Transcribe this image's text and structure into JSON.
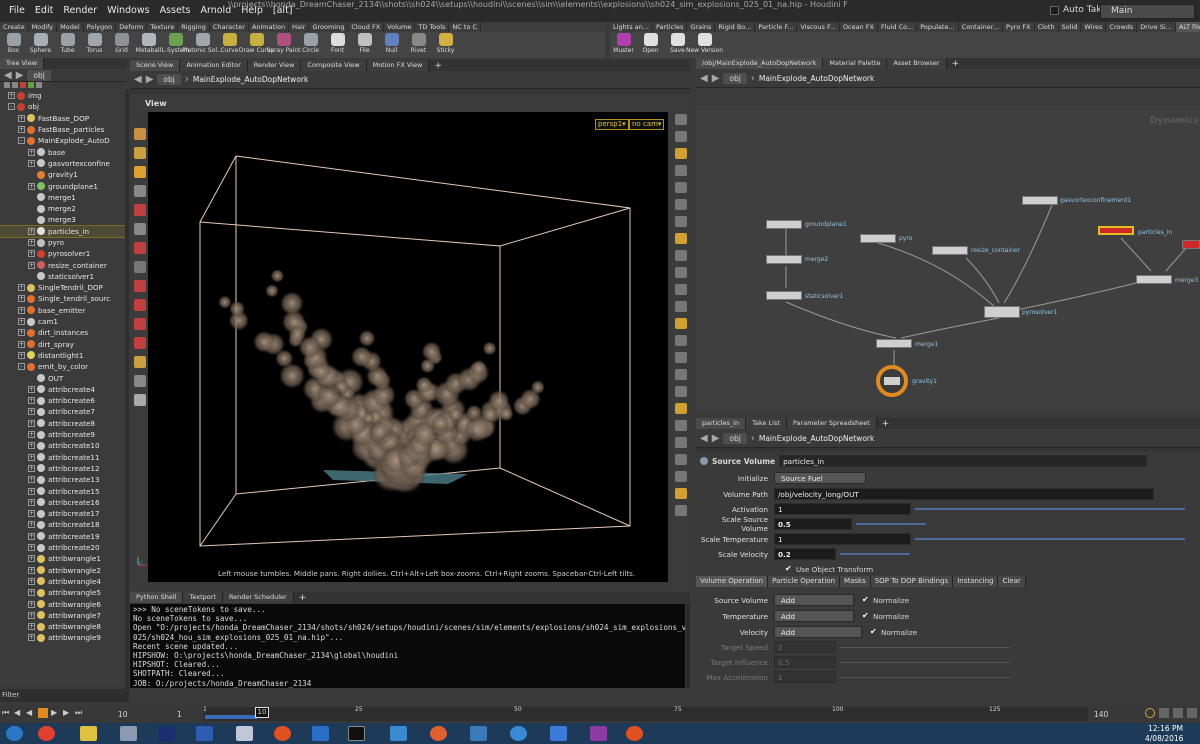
{
  "title_bar": "\\\\projects\\\\honda_DreamChaser_2134\\\\shots\\\\sh024\\\\setups\\\\houdini\\\\scenes\\\\sim\\\\elements\\\\explosions\\\\sh024_sim_explosions_025_01_na.hip - Houdini FX 15.0.313",
  "menu": [
    "File",
    "Edit",
    "Render",
    "Windows",
    "Assets",
    "Arnold",
    "Help",
    "[alt]"
  ],
  "auto_takes": "Auto Takes",
  "take": "Main",
  "shelf_tabs_left": [
    "Create",
    "Modify",
    "Model",
    "Polygon",
    "Deform",
    "Texture",
    "Rigging",
    "Character",
    "Animation",
    "Hair",
    "Grooming",
    "Cloud FX",
    "Volume",
    "TD Tools",
    "NC to C"
  ],
  "shelf_tabs_right": [
    "Lights an...",
    "Particles",
    "Grains",
    "Rigid Bo...",
    "Particle F...",
    "Viscous F...",
    "Ocean FX",
    "Fluid Co...",
    "Populate...",
    "Container...",
    "Pyro FX",
    "Cloth",
    "Solid",
    "Wires",
    "Crowds",
    "Drive Si...",
    "ALT file"
  ],
  "tools_left": [
    {
      "label": "Box",
      "color": "#9aa0a8"
    },
    {
      "label": "Sphere",
      "color": "#a8aeb6"
    },
    {
      "label": "Tube",
      "color": "#9aa0a8"
    },
    {
      "label": "Torus",
      "color": "#a0a6ae"
    },
    {
      "label": "Grid",
      "color": "#8c9298"
    },
    {
      "label": "Metaball",
      "color": "#b0b6be"
    },
    {
      "label": "L-System",
      "color": "#6aa050"
    },
    {
      "label": "Platonic Sol...",
      "color": "#a0a6ae"
    },
    {
      "label": "Curve",
      "color": "#c8b040"
    },
    {
      "label": "Draw Curve",
      "color": "#c8b040"
    },
    {
      "label": "Spray Paint",
      "color": "#b05080"
    },
    {
      "label": "Circle",
      "color": "#9aa0a8"
    },
    {
      "label": "Font",
      "color": "#ddd"
    },
    {
      "label": "File",
      "color": "#c0c0c0"
    },
    {
      "label": "Null",
      "color": "#6080c0"
    },
    {
      "label": "Rivet",
      "color": "#888"
    },
    {
      "label": "Sticky",
      "color": "#d0b040"
    }
  ],
  "tools_right": [
    {
      "label": "Muster",
      "color": "#b040b0"
    },
    {
      "label": "Open",
      "color": "#e0e0e0"
    },
    {
      "label": "Save",
      "color": "#e0e0e0"
    },
    {
      "label": "New Version",
      "color": "#e0e0e0"
    }
  ],
  "tree_view_tab": "Tree View",
  "tree_path": "obj",
  "tree": [
    {
      "label": "img",
      "indent": 0,
      "color": "#c84030",
      "exp": "+"
    },
    {
      "label": "obj",
      "indent": 0,
      "color": "#c84030",
      "exp": "-"
    },
    {
      "label": "FastBase_DOP",
      "indent": 1,
      "color": "#e0c060",
      "exp": "+"
    },
    {
      "label": "FastBase_particles",
      "indent": 1,
      "color": "#e07030",
      "exp": "+"
    },
    {
      "label": "MainExplode_AutoD",
      "indent": 1,
      "color": "#e07030",
      "exp": "-"
    },
    {
      "label": "base",
      "indent": 2,
      "color": "#c8c8c8",
      "exp": "+"
    },
    {
      "label": "gasvortexconfine",
      "indent": 2,
      "color": "#c8c8c8",
      "exp": "+"
    },
    {
      "label": "gravity1",
      "indent": 2,
      "color": "#e08030",
      "exp": ""
    },
    {
      "label": "groundplane1",
      "indent": 2,
      "color": "#80c060",
      "exp": "+"
    },
    {
      "label": "merge1",
      "indent": 2,
      "color": "#c8c8c8",
      "exp": ""
    },
    {
      "label": "merge2",
      "indent": 2,
      "color": "#c8c8c8",
      "exp": ""
    },
    {
      "label": "merge3",
      "indent": 2,
      "color": "#c8c8c8",
      "exp": ""
    },
    {
      "label": "particles_in",
      "indent": 2,
      "color": "#e0e0e0",
      "exp": "+",
      "sel": true
    },
    {
      "label": "pyro",
      "indent": 2,
      "color": "#c0c0c0",
      "exp": "+"
    },
    {
      "label": "pyrosolver1",
      "indent": 2,
      "color": "#d04030",
      "exp": "+"
    },
    {
      "label": "resize_container",
      "indent": 2,
      "color": "#d06060",
      "exp": "+"
    },
    {
      "label": "staticsolver1",
      "indent": 2,
      "color": "#c8c8c8",
      "exp": ""
    },
    {
      "label": "SingleTendril_DOP",
      "indent": 1,
      "color": "#e0c060",
      "exp": "+"
    },
    {
      "label": "Single_tendril_sourc",
      "indent": 1,
      "color": "#e07030",
      "exp": "+"
    },
    {
      "label": "base_emitter",
      "indent": 1,
      "color": "#e07030",
      "exp": "+"
    },
    {
      "label": "cam1",
      "indent": 1,
      "color": "#c8c8c8",
      "exp": "+"
    },
    {
      "label": "dirt_instances",
      "indent": 1,
      "color": "#e07030",
      "exp": "+"
    },
    {
      "label": "dirt_spray",
      "indent": 1,
      "color": "#e07030",
      "exp": "+"
    },
    {
      "label": "distantlight1",
      "indent": 1,
      "color": "#e0d060",
      "exp": "+"
    },
    {
      "label": "emit_by_color",
      "indent": 1,
      "color": "#e07030",
      "exp": "-"
    },
    {
      "label": "OUT",
      "indent": 2,
      "color": "#c8c8c8",
      "exp": ""
    },
    {
      "label": "attribcreate4",
      "indent": 2,
      "color": "#c8c8c8",
      "exp": "+"
    },
    {
      "label": "attribcreate6",
      "indent": 2,
      "color": "#c8c8c8",
      "exp": "+"
    },
    {
      "label": "attribcreate7",
      "indent": 2,
      "color": "#c8c8c8",
      "exp": "+"
    },
    {
      "label": "attribcreate8",
      "indent": 2,
      "color": "#c8c8c8",
      "exp": "+"
    },
    {
      "label": "attribcreate9",
      "indent": 2,
      "color": "#c8c8c8",
      "exp": "+"
    },
    {
      "label": "attribcreate10",
      "indent": 2,
      "color": "#c8c8c8",
      "exp": "+"
    },
    {
      "label": "attribcreate11",
      "indent": 2,
      "color": "#c8c8c8",
      "exp": "+"
    },
    {
      "label": "attribcreate12",
      "indent": 2,
      "color": "#c8c8c8",
      "exp": "+"
    },
    {
      "label": "attribcreate13",
      "indent": 2,
      "color": "#c8c8c8",
      "exp": "+"
    },
    {
      "label": "attribcreate15",
      "indent": 2,
      "color": "#c8c8c8",
      "exp": "+"
    },
    {
      "label": "attribcreate16",
      "indent": 2,
      "color": "#c8c8c8",
      "exp": "+"
    },
    {
      "label": "attribcreate17",
      "indent": 2,
      "color": "#c8c8c8",
      "exp": "+"
    },
    {
      "label": "attribcreate18",
      "indent": 2,
      "color": "#c8c8c8",
      "exp": "+"
    },
    {
      "label": "attribcreate19",
      "indent": 2,
      "color": "#c8c8c8",
      "exp": "+"
    },
    {
      "label": "attribcreate20",
      "indent": 2,
      "color": "#c8c8c8",
      "exp": "+"
    },
    {
      "label": "attribwrangle1",
      "indent": 2,
      "color": "#e0c060",
      "exp": "+"
    },
    {
      "label": "attribwrangle2",
      "indent": 2,
      "color": "#e0c060",
      "exp": "+"
    },
    {
      "label": "attribwrangle4",
      "indent": 2,
      "color": "#e0c060",
      "exp": "+"
    },
    {
      "label": "attribwrangle5",
      "indent": 2,
      "color": "#e0c060",
      "exp": "+"
    },
    {
      "label": "attribwrangle6",
      "indent": 2,
      "color": "#e0c060",
      "exp": "+"
    },
    {
      "label": "attribwrangle7",
      "indent": 2,
      "color": "#e0c060",
      "exp": "+"
    },
    {
      "label": "attribwrangle8",
      "indent": 2,
      "color": "#e0c060",
      "exp": "+"
    },
    {
      "label": "attribwrangle9",
      "indent": 2,
      "color": "#e0c060",
      "exp": "+"
    }
  ],
  "filter": "Filter",
  "viewer_tabs": [
    "Scene View",
    "Animation Editor",
    "Render View",
    "Composite View",
    "Motion FX View"
  ],
  "viewer_path": "obj",
  "viewer_net": "MainExplode_AutoDopNetwork",
  "view_label": "View",
  "persp": "persp1▾",
  "nocam": "no cam▾",
  "viewport_hint": "Left mouse tumbles. Middle pans. Right dollies. Ctrl+Alt+Left box-zooms. Ctrl+Right zooms. Spacebar-Ctrl-Left tilts.",
  "shell_tabs": [
    "Python Shell",
    "Textport",
    "Render Scheduler"
  ],
  "shell_lines": [
    ">>> No sceneTokens to save...",
    "No sceneTokens to save...",
    "Open \"O:/projects/honda_DreamChaser_2134/shots/sh024/setups/houdini/scenes/sim/elements/explosions/sh024_sim_explosions_v",
    "025/sh024_hou_sim_explosions_025_01_na.hip\"...",
    "Recent scene updated...",
    "HIPSHOW: O:\\projects\\honda_DreamChaser_2134\\global\\houdini",
    "HIPSHOT: Cleared...",
    "SHOTPATH: Cleared...",
    "JOB: O:/projects/honda_DreamChaser_2134"
  ],
  "net_tabs": [
    "/obj/MainExplode_AutoDopNetwork",
    "Material Palette",
    "Asset Browser"
  ],
  "net_path": "obj",
  "net_net": "MainExplode_AutoDopNetwork",
  "net_watermark": "Dynamics",
  "nodes": {
    "groundplane1": "groundplane1",
    "pyro": "pyro",
    "resize_container": "resize_container",
    "gasvortexconfinement1": "gasvortexconfinement1",
    "particles_in": "particles_in",
    "merge2": "merge2",
    "merge3": "merge3",
    "staticsolver1": "staticsolver1",
    "pyrosolver1": "pyrosolver1",
    "merge1": "merge1",
    "gravity1": "gravity1"
  },
  "param_tabs": [
    "particles_in",
    "Take List",
    "Parameter Spreadsheet"
  ],
  "param_path": "obj",
  "param_net": "MainExplode_AutoDopNetwork",
  "param_header": {
    "type": "Source Volume",
    "name": "particles_in"
  },
  "params": {
    "initialize_label": "Initialize",
    "initialize_value": "Source Fuel",
    "volume_path_label": "Volume Path",
    "volume_path_value": "/obj/velocity_long/OUT",
    "activation_label": "Activation",
    "activation_value": "1",
    "scale_source_volume_label": "Scale Source Volume",
    "scale_source_volume_value": "0.5",
    "scale_temperature_label": "Scale Temperature",
    "scale_temperature_value": "1",
    "scale_velocity_label": "Scale Velocity",
    "scale_velocity_value": "0.2",
    "use_object_transform": "Use Object Transform"
  },
  "param_subtabs": [
    "Volume Operation",
    "Particle Operation",
    "Masks",
    "SOP To DOP Bindings",
    "Instancing",
    "Clear"
  ],
  "vol_ops": [
    {
      "label": "Source Volume",
      "value": "Add",
      "norm": "Normalize"
    },
    {
      "label": "Temperature",
      "value": "Add",
      "norm": "Normalize"
    },
    {
      "label": "Velocity",
      "value": "Add",
      "norm": "Normalize"
    }
  ],
  "disabled_params": [
    {
      "label": "Target Speed",
      "value": "2"
    },
    {
      "label": "Target Influence",
      "value": "0.5"
    },
    {
      "label": "Max Acceleration",
      "value": "1"
    }
  ],
  "timeline": {
    "current_frame": "10",
    "start": "1",
    "end": "140",
    "ticks": [
      "1",
      "25",
      "50",
      "75",
      "100",
      "125"
    ]
  },
  "clock": {
    "time": "12:16 PM",
    "date": "4/08/2016"
  }
}
